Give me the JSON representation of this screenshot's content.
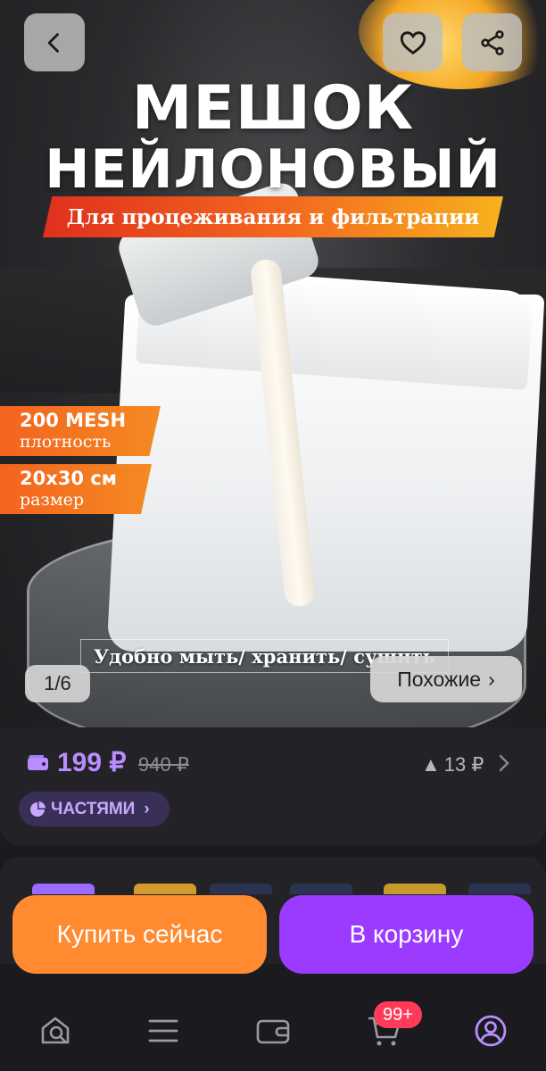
{
  "hero": {
    "title_line1": "МЕШОК",
    "title_line2": "НЕЙЛОНОВЫЙ",
    "subtitle": "Для процеживания и фильтрации",
    "specs": [
      {
        "value": "200 MESH",
        "label": "плотность"
      },
      {
        "value": "20x30 см",
        "label": "размер"
      }
    ],
    "feature_caption": "Удобно мыть/ хранить/ сушить",
    "counter": "1/6",
    "similar_label": "Похожие",
    "similar_chevron": "›"
  },
  "header": {
    "back_icon": "chevron-left-icon",
    "favorite_icon": "heart-icon",
    "share_icon": "share-icon"
  },
  "price": {
    "current": "199 ₽",
    "old": "940 ₽",
    "cashback": "13 ₽",
    "cashback_arrow": "▲",
    "installments_label": "ЧАСТЯМИ",
    "accent_color": "#b98cff"
  },
  "actions": {
    "buy_now": "Купить сейчас",
    "add_to_cart": "В корзину",
    "buy_now_color": "#ff8a30",
    "cart_color": "#9b3bff"
  },
  "nav": {
    "cart_badge": "99+",
    "items": [
      "home-search-icon",
      "catalog-icon",
      "wallet-icon",
      "cart-icon",
      "profile-icon"
    ]
  }
}
